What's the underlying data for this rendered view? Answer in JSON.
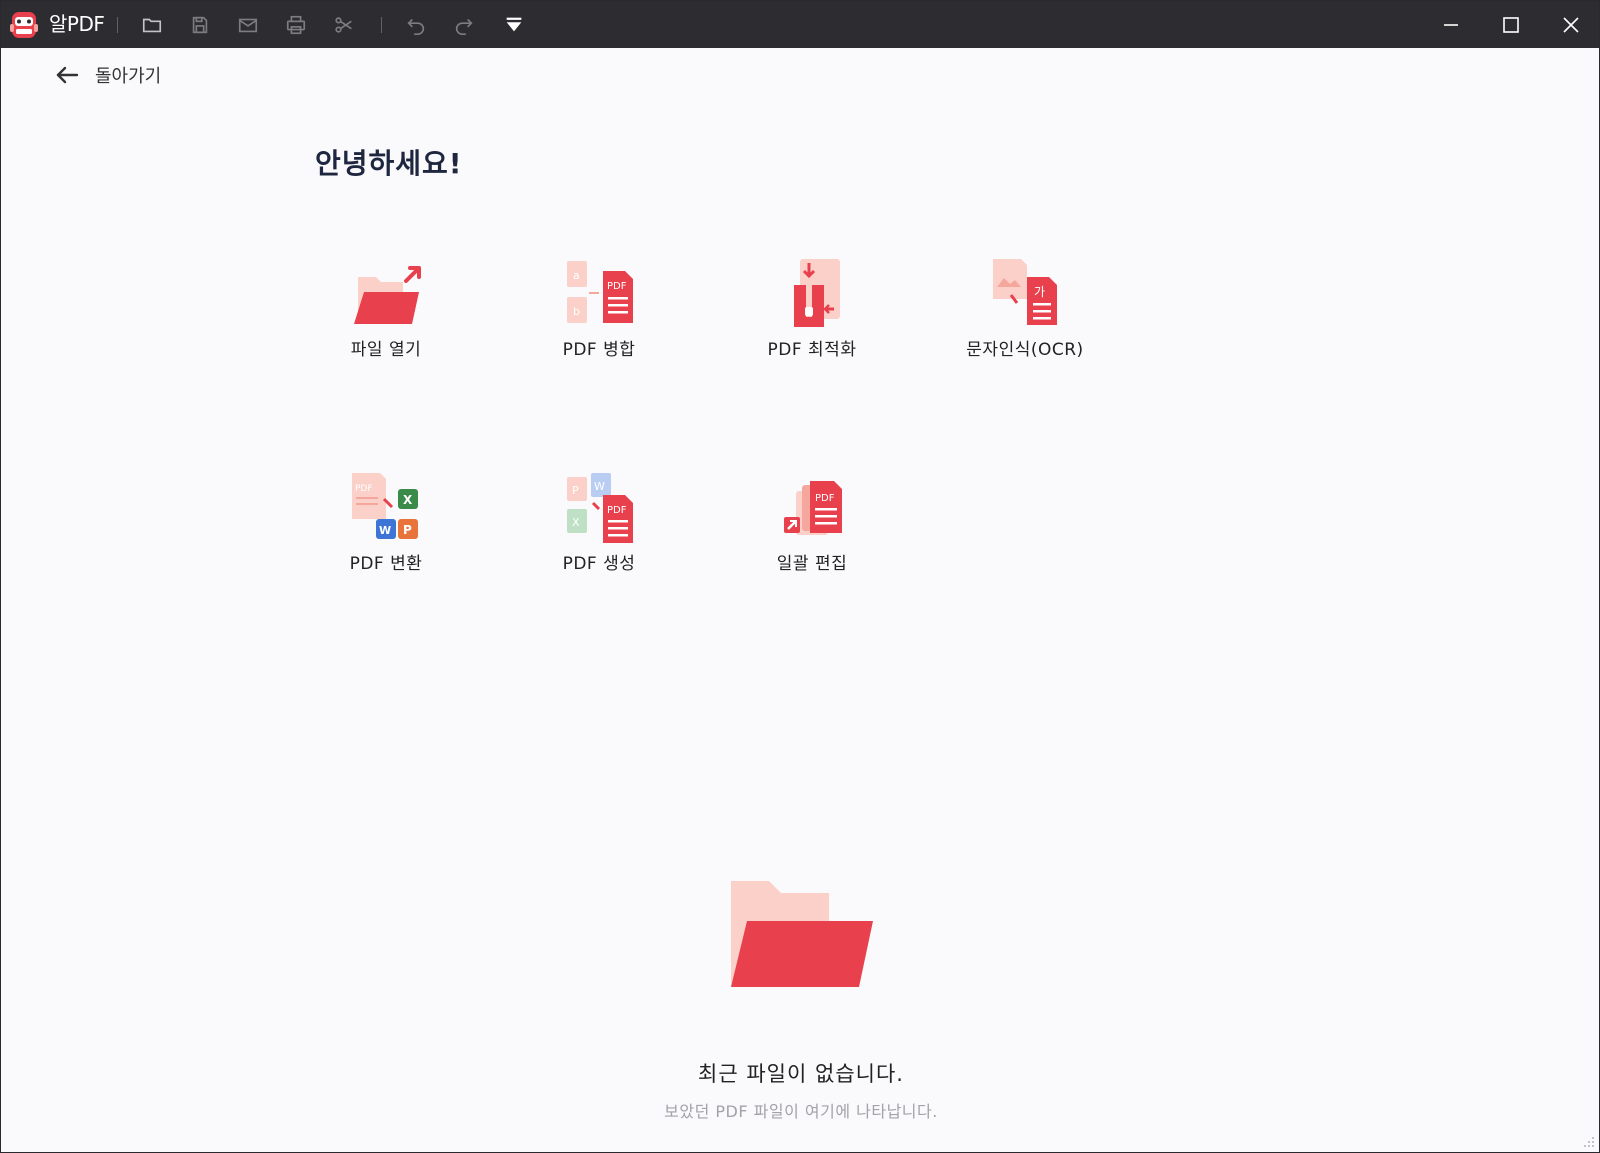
{
  "titlebar": {
    "app_name": "알PDF",
    "icons": [
      "open-folder-icon",
      "save-icon",
      "mail-icon",
      "print-icon",
      "scissors-icon",
      "undo-icon",
      "redo-icon",
      "quick-access-dropdown-icon"
    ],
    "window_controls": [
      "minimize-icon",
      "maximize-icon",
      "close-icon"
    ]
  },
  "nav": {
    "back_label": "돌아가기"
  },
  "greeting": "안녕하세요!",
  "tools": [
    {
      "label": "파일 열기",
      "icon": "open-file-icon"
    },
    {
      "label": "PDF 병합",
      "icon": "pdf-merge-icon"
    },
    {
      "label": "PDF 최적화",
      "icon": "pdf-optimize-icon"
    },
    {
      "label": "문자인식(OCR)",
      "icon": "ocr-icon"
    },
    {
      "label": "PDF 변환",
      "icon": "pdf-convert-icon"
    },
    {
      "label": "PDF 생성",
      "icon": "pdf-create-icon"
    },
    {
      "label": "일괄 편집",
      "icon": "batch-edit-icon"
    }
  ],
  "icon_text": {
    "pdf": "PDF",
    "a": "a",
    "b": "b",
    "ga": "가",
    "x": "X",
    "w": "W",
    "p": "P"
  },
  "empty_state": {
    "title": "최근 파일이 없습니다.",
    "subtitle": "보았던 PDF 파일이 여기에 나타납니다."
  },
  "colors": {
    "titlebar": "#2d2d31",
    "accent": "#e8404c",
    "accent_light": "#f9c6c0",
    "background": "#fafafc"
  }
}
